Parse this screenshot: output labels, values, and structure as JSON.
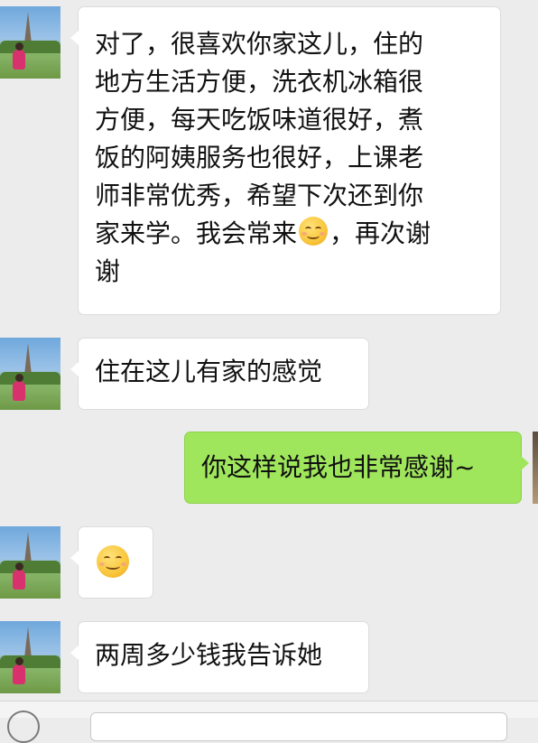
{
  "messages": [
    {
      "direction": "in",
      "lines": [
        "对了，很喜欢你家这儿，住的",
        "地方生活方便，洗衣机冰箱很",
        "方便，每天吃饭味道很好，煮",
        "饭的阿姨服务也很好，上课老",
        "师非常优秀，希望下次还到你",
        "家来学。我会常来",
        "，再次谢",
        "谢"
      ],
      "emoji": "smile-emoji"
    },
    {
      "direction": "in",
      "text": "住在这儿有家的感觉"
    },
    {
      "direction": "out",
      "text": "你这样说我也非常感谢~"
    },
    {
      "direction": "in",
      "emoji": "smile-emoji"
    },
    {
      "direction": "in",
      "text": "两周多少钱我告诉她"
    }
  ],
  "colors": {
    "background": "#ececec",
    "incoming_bubble": "#ffffff",
    "outgoing_bubble": "#9fe65c"
  }
}
